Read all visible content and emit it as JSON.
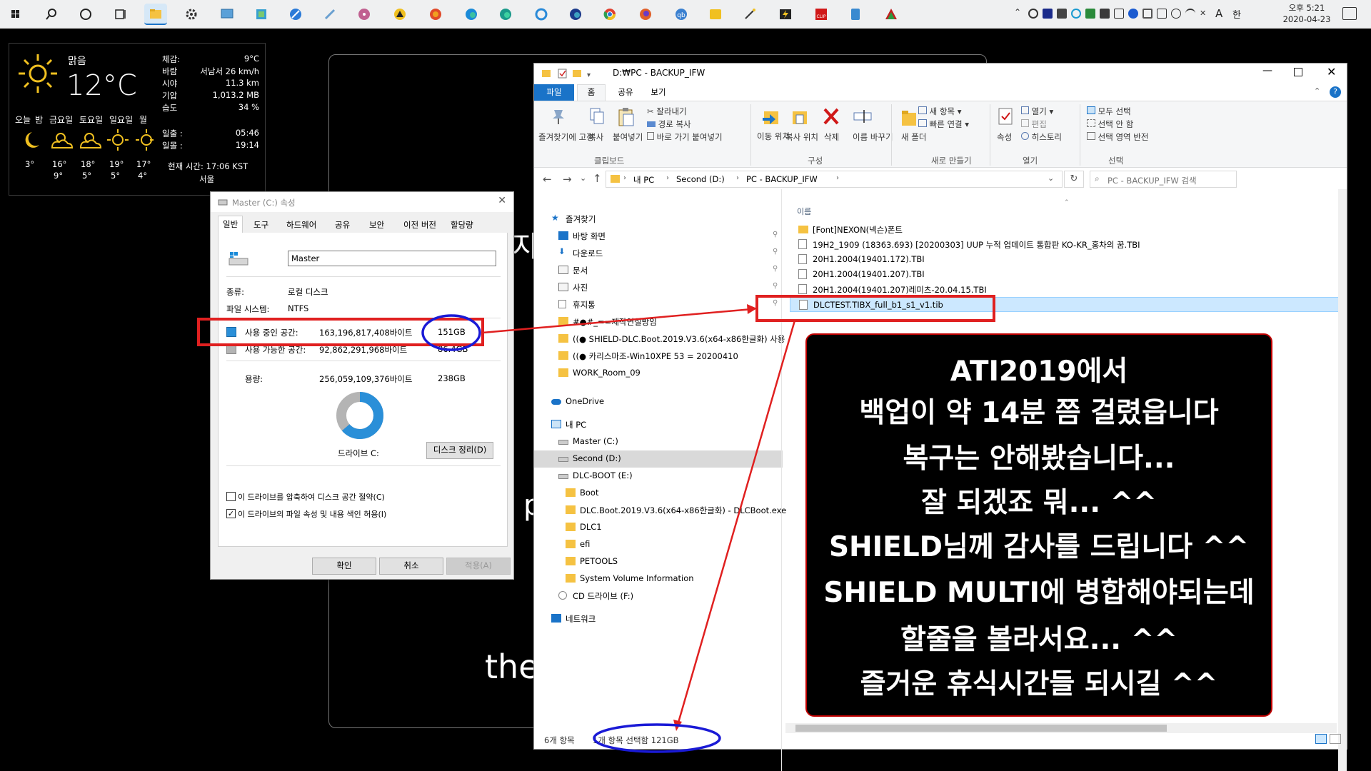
{
  "taskbar": {
    "clock_time": "오후 5:21",
    "clock_date": "2020-04-23",
    "ime_mode": "A",
    "ime_lang": "한",
    "colors": {
      "bar": "#eff0f1"
    }
  },
  "weather": {
    "condition": "맑음",
    "temperature": "12°C",
    "details": [
      {
        "label": "체감:",
        "value": "9°C"
      },
      {
        "label": "바람",
        "value": "서남서 26 km/h"
      },
      {
        "label": "시야",
        "value": "11.3 km"
      },
      {
        "label": "기압",
        "value": "1,013.2 MB"
      },
      {
        "label": "습도",
        "value": "34 %"
      }
    ],
    "days": [
      "오늘",
      "밤",
      "금요일",
      "토요일",
      "일요일",
      "월"
    ],
    "highs": [
      "3°",
      "16°",
      "18°",
      "19°",
      "17°"
    ],
    "lows": [
      "9°",
      "5°",
      "5°",
      "4°"
    ],
    "sunrise_label": "일출 :",
    "sunrise": "05:46",
    "sunset_label": "일몰 :",
    "sunset": "19:14",
    "current_time": "현재 시간: 17:06 KST",
    "city": "서울"
  },
  "background_slide": {
    "fragment1": "지",
    "fragment2": "p",
    "fragment3": "the"
  },
  "properties": {
    "title": "Master (C:) 속성",
    "tabs": [
      "일반",
      "도구",
      "하드웨어",
      "공유",
      "보안",
      "이전 버전",
      "할당량"
    ],
    "drive_name": "Master",
    "type_label": "종류:",
    "type_value": "로컬 디스크",
    "fs_label": "파일 시스템:",
    "fs_value": "NTFS",
    "used_label": "사용 중인 공간:",
    "used_bytes": "163,196,817,408바이트",
    "used_gb": "151GB",
    "free_label": "사용 가능한 공간:",
    "free_bytes": "92,862,291,968바이트",
    "free_gb": "86.4GB",
    "capacity_label": "용량:",
    "capacity_bytes": "256,059,109,376바이트",
    "capacity_gb": "238GB",
    "drive_label": "드라이브 C:",
    "cleanup_button": "디스크 정리(D)",
    "compress_checkbox": "이 드라이브를 압축하여 디스크 공간 절약(C)",
    "index_checkbox": "이 드라이브의 파일 속성 및 내용 색인 허용(I)",
    "compress_checked": false,
    "index_checked": true,
    "ok_button": "확인",
    "cancel_button": "취소",
    "apply_button": "적용(A)",
    "used_fraction": 0.637,
    "colors": {
      "used": "#2a8fd8",
      "free": "#b4b4b4"
    }
  },
  "explorer": {
    "title": "D:₩PC - BACKUP_IFW",
    "ribbon_tabs": [
      "파일",
      "홈",
      "공유",
      "보기"
    ],
    "clipboard": {
      "pin": "즐겨찾기에 고정",
      "copy": "복사",
      "paste": "붙여넣기",
      "cut": "잘라내기",
      "copy_path": "경로 복사",
      "paste_shortcut": "바로 가기 붙여넣기",
      "group": "클립보드"
    },
    "organize": {
      "move": "이동 위치",
      "copy_to": "복사 위치",
      "delete": "삭제",
      "rename": "이름 바꾸기",
      "group": "구성"
    },
    "new": {
      "new_folder": "새 폴더",
      "new_item": "새 항목",
      "easy_access": "빠른 연결",
      "group": "새로 만들기"
    },
    "open": {
      "properties": "속성",
      "open": "열기",
      "edit": "편집",
      "history": "히스토리",
      "group": "열기"
    },
    "select": {
      "select_all": "모두 선택",
      "select_none": "선택 안 함",
      "invert": "선택 영역 반전",
      "group": "선택"
    },
    "breadcrumb": [
      "내 PC",
      "Second (D:)",
      "PC - BACKUP_IFW"
    ],
    "search_placeholder": "PC - BACKUP_IFW 검색",
    "column_name": "이름",
    "nav": [
      {
        "label": "즐겨찾기",
        "indent": 0,
        "pinned": false
      },
      {
        "label": "바탕 화면",
        "indent": 1,
        "pinned": true
      },
      {
        "label": "다운로드",
        "indent": 1,
        "pinned": true
      },
      {
        "label": "문서",
        "indent": 1,
        "pinned": true
      },
      {
        "label": "사진",
        "indent": 1,
        "pinned": true
      },
      {
        "label": "휴지통",
        "indent": 1,
        "pinned": true
      },
      {
        "label": "#●#_==제작연실방임",
        "indent": 1,
        "pinned": false
      },
      {
        "label": "((● SHIELD-DLC.Boot.2019.V3.6(x64-x86한글화) 사용",
        "indent": 1,
        "pinned": false
      },
      {
        "label": "((● 카리스마조-Win10XPE 53 = 20200410",
        "indent": 1,
        "pinned": false
      },
      {
        "label": "WORK_Room_09",
        "indent": 1,
        "pinned": false
      },
      {
        "label": "OneDrive",
        "indent": 0,
        "pinned": false
      },
      {
        "label": "내 PC",
        "indent": 0,
        "pinned": false
      },
      {
        "label": "Master (C:)",
        "indent": 1,
        "pinned": false
      },
      {
        "label": "Second (D:)",
        "indent": 1,
        "pinned": false,
        "selected": true
      },
      {
        "label": "DLC-BOOT (E:)",
        "indent": 1,
        "pinned": false
      },
      {
        "label": "Boot",
        "indent": 2,
        "pinned": false
      },
      {
        "label": "DLC.Boot.2019.V3.6(x64-x86한글화) - DLCBoot.exe",
        "indent": 2,
        "pinned": false
      },
      {
        "label": "DLC1",
        "indent": 2,
        "pinned": false
      },
      {
        "label": "efi",
        "indent": 2,
        "pinned": false
      },
      {
        "label": "PETOOLS",
        "indent": 2,
        "pinned": false
      },
      {
        "label": "System Volume Information",
        "indent": 2,
        "pinned": false
      },
      {
        "label": "CD 드라이브 (F:)",
        "indent": 1,
        "pinned": false
      },
      {
        "label": "네트워크",
        "indent": 0,
        "pinned": false
      }
    ],
    "files": [
      {
        "name": "[Font]NEXON(넥슨)폰트",
        "kind": "folder"
      },
      {
        "name": "19H2_1909 (18363.693) [20200303] UUP 누적 업데이트 통합판 KO-KR_홍차의 꿈.TBI",
        "kind": "file"
      },
      {
        "name": "20H1.2004(19401.172).TBI",
        "kind": "file"
      },
      {
        "name": "20H1.2004(19401.207).TBI",
        "kind": "file"
      },
      {
        "name": "20H1.2004(19401.207)레미츠-20.04.15.TBI",
        "kind": "file"
      },
      {
        "name": "DLCTEST.TIBX_full_b1_s1_v1.tib",
        "kind": "file",
        "selected": true
      }
    ],
    "status_count": "6개 항목",
    "status_selected": "1개 항목 선택함 121GB",
    "colors": {
      "accent": "#1a73c8",
      "selection": "#cce8ff"
    }
  },
  "note": {
    "lines": [
      "ATI2019에서",
      "백업이 약 14분 쯤 걸렸읍니다",
      "복구는 안해봤습니다...",
      "잘 되겠죠 뭐... ^^",
      "SHIELD님께 감사를 드립니다 ^^",
      "SHIELD MULTI에 병합해야되는데",
      "할줄을 볼라서요... ^^",
      "즐거운 휴식시간들 되시길 ^^"
    ],
    "colors": {
      "border": "#c00000"
    }
  },
  "annotations": {
    "colors": {
      "arrow": "#e02020",
      "ellipse": "#1a1ad6"
    }
  }
}
